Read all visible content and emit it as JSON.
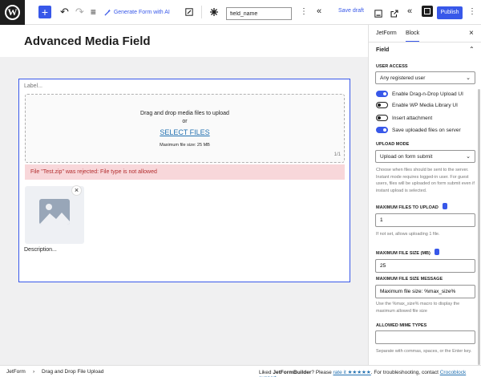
{
  "toolbar": {
    "wp_logo": "W",
    "add_icon": "+",
    "undo_icon": "↶",
    "redo_icon": "↷",
    "list_view_icon": "≡",
    "generate_label": "Generate Form with AI",
    "field_name_value": "field_name",
    "save_draft_label": "Save draft",
    "publish_label": "Publish"
  },
  "editor": {
    "page_title": "Advanced Media Field",
    "field": {
      "label": "Label...",
      "dropzone_text": "Drag and drop media files to upload",
      "or_text": "or",
      "select_files_label": "SELECT FILES",
      "max_size_text": "Maximum file size: 25 MB",
      "file_count": "1/1",
      "error_text": "File \"Test.zip\" was rejected: File type is not allowed",
      "thumb_close": "×",
      "description": "Description..."
    }
  },
  "sidebar": {
    "tabs": [
      "JetForm",
      "Block"
    ],
    "active_tab": "Block",
    "close_icon": "×",
    "section_title": "Field",
    "user_access": {
      "label": "USER ACCESS",
      "value": "Any registered user"
    },
    "toggles": [
      {
        "label": "Enable Drag-n-Drop Upload UI",
        "on": true
      },
      {
        "label": "Enable WP Media Library UI",
        "on": false
      },
      {
        "label": "Insert attachment",
        "on": false
      },
      {
        "label": "Save uploaded files on server",
        "on": true
      }
    ],
    "upload_mode": {
      "label": "UPLOAD MODE",
      "value": "Upload on form submit",
      "help": "Choose when files should be sent to the server. Instant mode requires logged-in user. For guest users, files will be uploaded on form submit even if instant upload is selected."
    },
    "max_files": {
      "label": "MAXIMUM FILES TO UPLOAD",
      "value": "1",
      "help": "If not set, allows uploading 1 file."
    },
    "max_size": {
      "label": "MAXIMUM FILE SIZE (MB)",
      "value": "25"
    },
    "max_size_message": {
      "label": "MAXIMUM FILE SIZE MESSAGE",
      "value": "Maximum file size: %max_size%",
      "help": "Use the %max_size% macro to display the maximum allowed file size"
    },
    "mime_types": {
      "label": "ALLOWED MIME TYPES",
      "value": "",
      "help": "Separate with commas, spaces, or the Enter key."
    }
  },
  "statusbar": {
    "breadcrumb_root": "JetForm",
    "breadcrumb_current": "Drag and Drop File Upload",
    "rate_prefix": "Liked",
    "rate_brand": "JetFormBuilder",
    "rate_middle": "? Please",
    "rate_link": "rate it ★★★★★",
    "rate_support_prefix": ". For troubleshooting, contact",
    "rate_support_link": "Crocoblock support",
    "rate_suffix": "."
  },
  "colors": {
    "accent": "#3858e9",
    "error_bg": "#f8d7da",
    "error_text": "#b32d2e",
    "link": "#2271b1"
  }
}
